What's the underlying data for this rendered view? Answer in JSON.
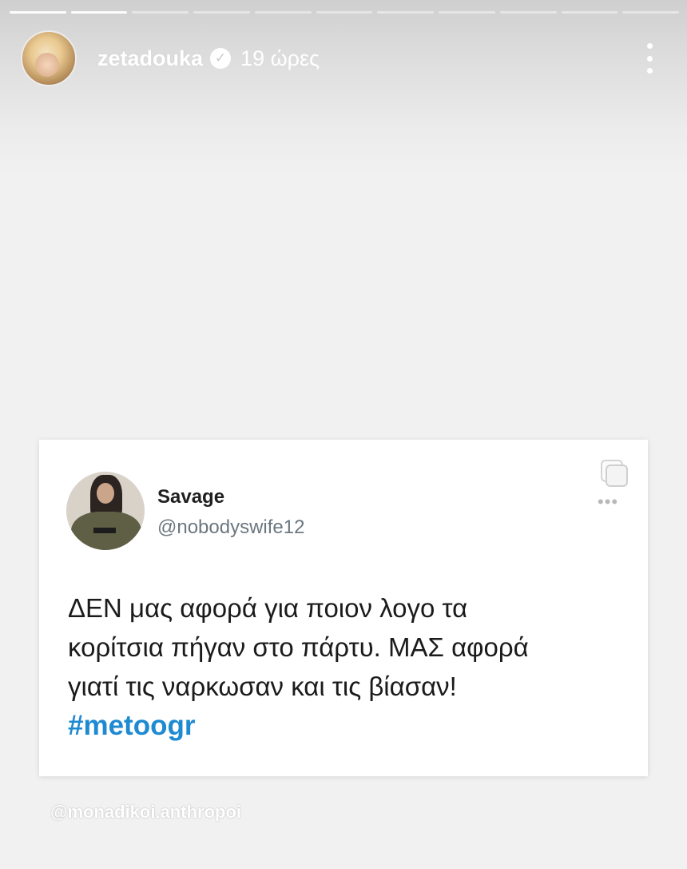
{
  "story": {
    "progress_total": 11,
    "progress_done": 2,
    "username": "zetadouka",
    "verified_icon": "verified-check-icon",
    "time": "19 ώρες",
    "more_icon": "vertical-ellipsis-icon"
  },
  "tweet": {
    "name": "Savage",
    "handle": "@nobodyswife12",
    "lines": [
      "ΔΕΝ μας αφορά για ποιον λογο τα",
      "κορίτσια πήγαν στο πάρτυ. ΜΑΣ αφορά",
      "γιατί τις ναρκωσαν και τις βίασαν!"
    ],
    "hashtag": "#metoogr",
    "copy_icon": "copy-icon",
    "more_icon": "horizontal-ellipsis-icon"
  },
  "watermark": "@monadikoi.anthropoi",
  "colors": {
    "hashtag": "#1d8ad1",
    "background": "#f1f1f1",
    "card": "#ffffff"
  }
}
